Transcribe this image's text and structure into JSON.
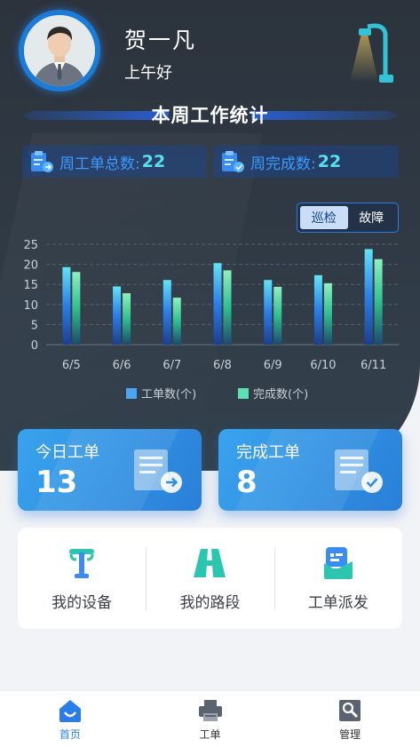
{
  "user": {
    "name": "贺一凡",
    "greeting": "上午好"
  },
  "section_title": "本周工作统计",
  "stats": {
    "week_total_label": "周工单总数:",
    "week_total_value": "22",
    "week_done_label": "周完成数:",
    "week_done_value": "22"
  },
  "toggle": {
    "options": [
      "巡检",
      "故障"
    ],
    "selected": "巡检"
  },
  "chart_data": {
    "type": "bar",
    "categories": [
      "6/5",
      "6/6",
      "6/7",
      "6/8",
      "6/9",
      "6/10",
      "6/11"
    ],
    "series": [
      {
        "name": "工单数(个)",
        "values": [
          19.3,
          14.5,
          16.1,
          20.3,
          16.1,
          17.3,
          23.8
        ],
        "color": "#4aa6f5"
      },
      {
        "name": "完成数(个)",
        "values": [
          18.1,
          12.8,
          11.7,
          18.5,
          14.4,
          15.3,
          21.3
        ],
        "color": "#5fe0b0"
      }
    ],
    "yticks": [
      0,
      5,
      10,
      15,
      20,
      25
    ],
    "ylim": [
      0,
      25
    ],
    "grid": "dashed horizontal",
    "legend_position": "bottom"
  },
  "cards": {
    "today": {
      "label": "今日工单",
      "value": "13"
    },
    "done": {
      "label": "完成工单",
      "value": "8"
    }
  },
  "menu": {
    "devices": "我的设备",
    "roads": "我的路段",
    "dispatch": "工单派发"
  },
  "tabbar": {
    "home": "首页",
    "orders": "工单",
    "manage": "管理",
    "active": "首页"
  },
  "colors": {
    "accent": "#2a7de8",
    "bar_order": "#4aa6f5",
    "bar_done": "#5fe0b0",
    "card_blue": "#3aa3ee"
  }
}
